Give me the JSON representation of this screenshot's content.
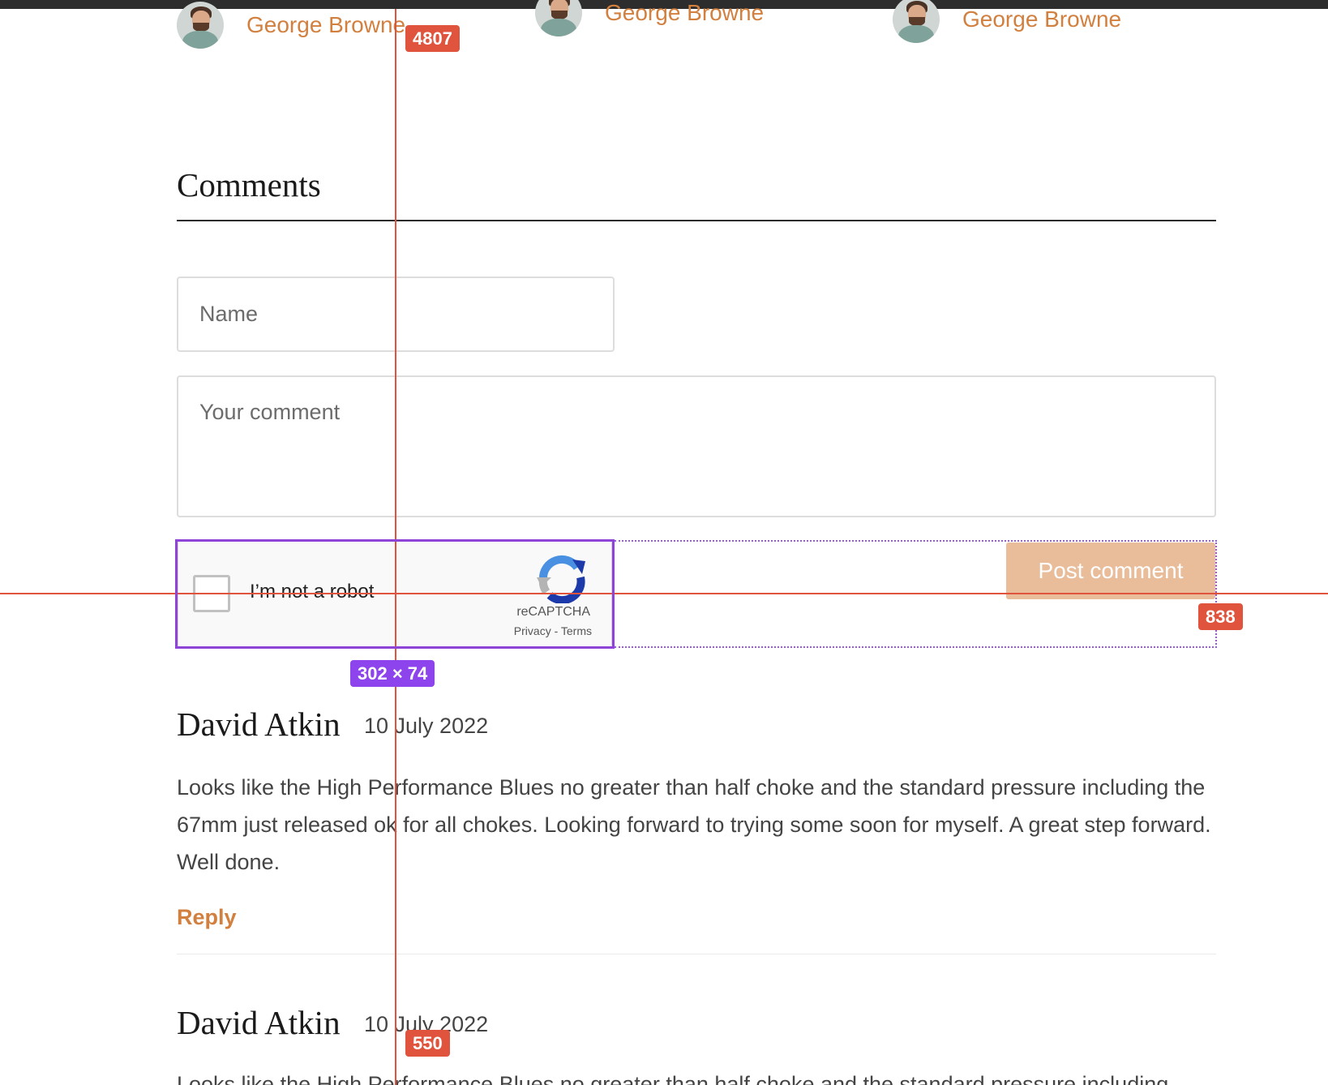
{
  "related_authors": [
    {
      "name": "George Browne"
    },
    {
      "name": "George Browne"
    },
    {
      "name": "George Browne"
    }
  ],
  "comments_section": {
    "heading": "Comments",
    "name_placeholder": "Name",
    "comment_placeholder": "Your comment",
    "recaptcha": {
      "label": "I’m not a robot",
      "brand": "reCAPTCHA",
      "links": "Privacy - Terms"
    },
    "post_button": "Post comment"
  },
  "comments": [
    {
      "author": "David Atkin",
      "date": "10 July 2022",
      "text": "Looks like the High Performance Blues no greater than half choke and the standard pressure including the 67mm just released ok for all chokes. Looking forward to trying some soon for myself. A great step forward. Well done.",
      "reply_label": "Reply"
    },
    {
      "author": "David Atkin",
      "date": "10 July 2022",
      "text": "Looks like the High Performance Blues no greater than half choke and the standard pressure including"
    }
  ],
  "measure_overlay": {
    "badge_top": "4807",
    "badge_right": "838",
    "badge_bottom": "550",
    "selection_size": "302 × 74"
  },
  "colors": {
    "accent": "#d2803f",
    "button_disabled": "#e9bc9a",
    "guide": "#e0533c",
    "selection": "#8e44ec"
  }
}
